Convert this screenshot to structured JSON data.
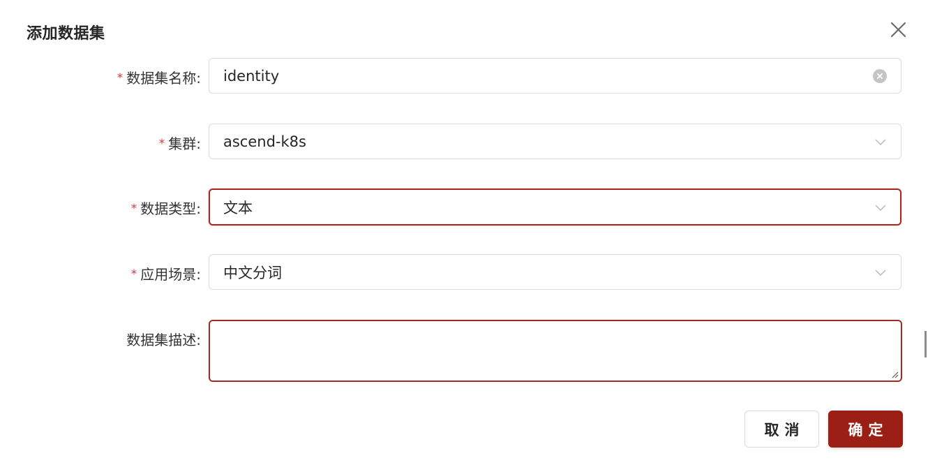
{
  "dialog": {
    "title": "添加数据集"
  },
  "form": {
    "name": {
      "label": "数据集名称:",
      "required": true,
      "value": "identity"
    },
    "cluster": {
      "label": "集群:",
      "required": true,
      "value": "ascend-k8s"
    },
    "data_type": {
      "label": "数据类型:",
      "required": true,
      "value": "文本"
    },
    "scenario": {
      "label": "应用场景:",
      "required": true,
      "value": "中文分词"
    },
    "description": {
      "label": "数据集描述:",
      "required": false,
      "value": ""
    }
  },
  "footer": {
    "cancel_label": "取消",
    "ok_label": "确定"
  },
  "icons": {
    "close": "close-icon",
    "clear": "clear-input-icon",
    "dropdown": "chevron-down-icon",
    "resize": "resize-grip-icon"
  },
  "colors": {
    "accent": "#9c1f16",
    "required": "#d9363e",
    "border": "#dcdcdc"
  }
}
